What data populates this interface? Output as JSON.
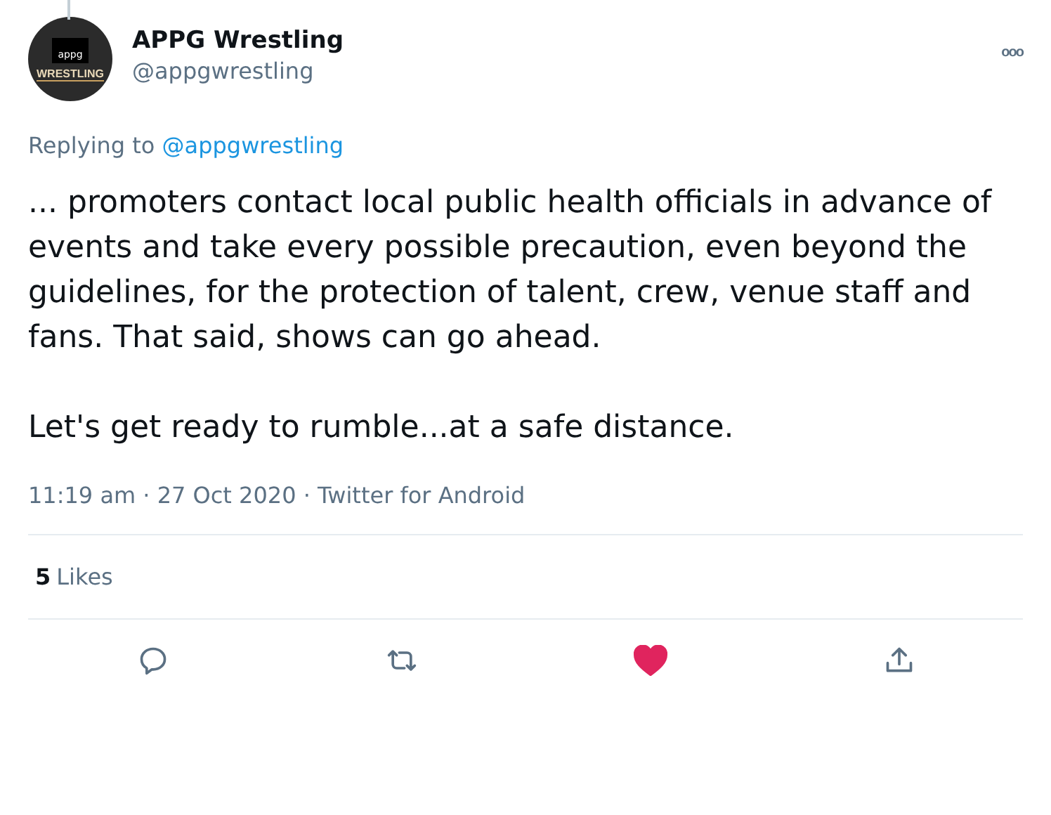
{
  "author": {
    "name": "APPG Wrestling",
    "handle": "@appgwrestling",
    "avatar": {
      "top": "appg",
      "bottom": "WRESTLING"
    }
  },
  "more_button": "ooo",
  "replying_to": {
    "label": "Replying to",
    "handle": "@appgwrestling"
  },
  "paragraphs": [
    "... promoters contact local public health officials in advance of events and take every possible precaution, even beyond the guidelines, for the protection of talent, crew, venue staff and fans. That said, shows can go ahead.",
    "Let's get ready to rumble...at a safe distance."
  ],
  "meta": "11:19 am · 27 Oct 2020 · Twitter for Android",
  "likes": {
    "count": "5",
    "label": "Likes"
  },
  "actions": {
    "liked": true
  }
}
